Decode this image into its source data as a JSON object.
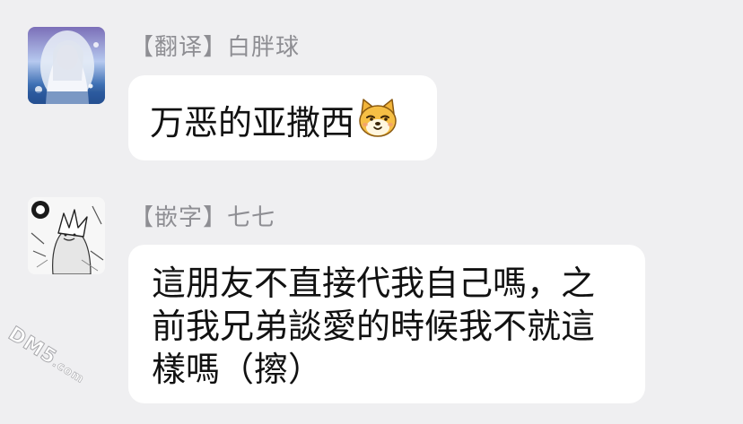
{
  "messages": [
    {
      "sender": "【翻译】白胖球",
      "text": "万恶的亚撒西",
      "emoji": "shiba-dog-sticker"
    },
    {
      "sender": "【嵌字】七七",
      "text": "這朋友不直接代我自己嗎，之前我兄弟談愛的時候我不就這樣嗎（擦）"
    }
  ],
  "watermark": {
    "main": "DM5",
    "suffix": ".com"
  },
  "colors": {
    "background": "#efeff1",
    "bubble": "#ffffff",
    "sender_text": "#8e8e93",
    "message_text": "#111111"
  }
}
